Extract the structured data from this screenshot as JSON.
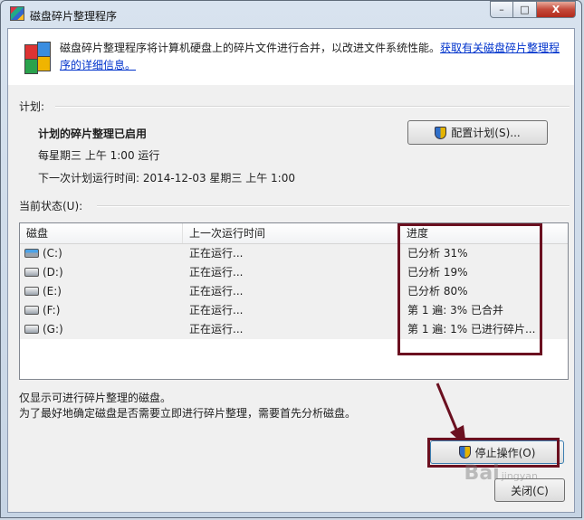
{
  "window": {
    "title": "磁盘碎片整理程序",
    "caption_min": "–",
    "caption_max": "□",
    "caption_close": "X"
  },
  "header": {
    "description": "磁盘碎片整理程序将计算机硬盘上的碎片文件进行合并，以改进文件系统性能。",
    "link_text": "获取有关磁盘碎片整理程序的详细信息。"
  },
  "schedule": {
    "section_label": "计划:",
    "status": "计划的碎片整理已启用",
    "frequency": "每星期三 上午 1:00 运行",
    "next_run": "下一次计划运行时间: 2014-12-03 星期三 上午 1:00",
    "configure_button": "配置计划(S)..."
  },
  "current_status": {
    "section_label": "当前状态(U):",
    "columns": [
      "磁盘",
      "上一次运行时间",
      "进度"
    ],
    "disks": [
      {
        "name": "(C:)",
        "last_run": "正在运行...",
        "progress": "已分析 31%",
        "system": true
      },
      {
        "name": "(D:)",
        "last_run": "正在运行...",
        "progress": "已分析 19%",
        "system": false
      },
      {
        "name": "(E:)",
        "last_run": "正在运行...",
        "progress": "已分析 80%",
        "system": false
      },
      {
        "name": "(F:)",
        "last_run": "正在运行...",
        "progress": "第 1 遍: 3% 已合并",
        "system": false
      },
      {
        "name": "(G:)",
        "last_run": "正在运行...",
        "progress": "第 1 遍: 1% 已进行碎片...",
        "system": false
      }
    ]
  },
  "notes": {
    "line1": "仅显示可进行碎片整理的磁盘。",
    "line2": "为了最好地确定磁盘是否需要立即进行碎片整理，需要首先分析磁盘。"
  },
  "buttons": {
    "stop": "停止操作(O)",
    "close": "关闭(C)"
  },
  "colors": {
    "highlight": "#6b1020",
    "link": "#0033cc"
  },
  "watermark": {
    "brand": "Bai",
    "sub": "jingyan"
  }
}
